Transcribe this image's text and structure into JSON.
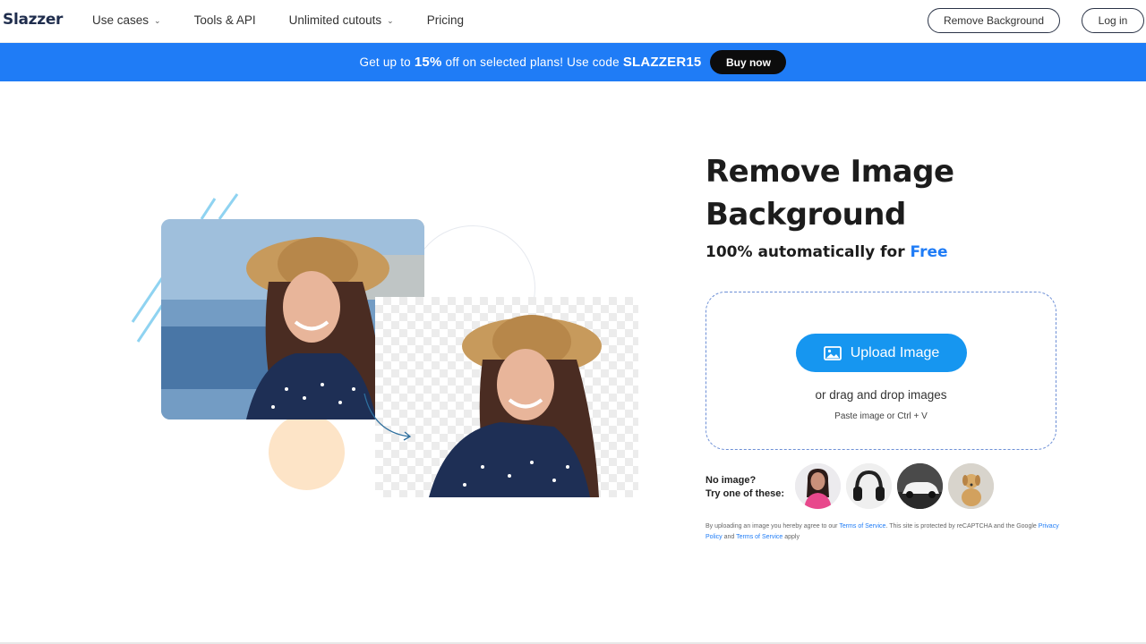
{
  "header": {
    "logo": "Slazzer",
    "nav": [
      {
        "label": "Use cases",
        "has_dropdown": true
      },
      {
        "label": "Tools & API",
        "has_dropdown": false
      },
      {
        "label": "Unlimited cutouts",
        "has_dropdown": true
      },
      {
        "label": "Pricing",
        "has_dropdown": false
      }
    ],
    "remove_bg_label": "Remove Background",
    "login_label": "Log in"
  },
  "banner": {
    "text_before": "Get up to",
    "discount": "15%",
    "text_middle": "off on selected plans! Use code",
    "code": "SLAZZER15",
    "buy_label": "Buy now",
    "color": "#1f7cf6"
  },
  "hero": {
    "title": "Remove Image Background",
    "subtitle_prefix": "100% automatically for",
    "subtitle_highlight": "Free",
    "highlight_color": "#1f7cf6"
  },
  "upload": {
    "button_label": "Upload Image",
    "button_icon": "image-icon",
    "drag_text": "or drag and drop images",
    "paste_text": "Paste image or Ctrl + V"
  },
  "samples": {
    "prompt_line1": "No image?",
    "prompt_line2": "Try one of these:",
    "items": [
      "woman",
      "headphones",
      "car",
      "dog"
    ]
  },
  "terms": {
    "t1": "By uploading an image you hereby agree to our",
    "link1": "Terms of Service",
    "t2": ". This site is protected by reCAPTCHA and the Google",
    "link2": "Privacy Policy",
    "t3": "and",
    "link3": "Terms of Service",
    "t4": "apply"
  }
}
